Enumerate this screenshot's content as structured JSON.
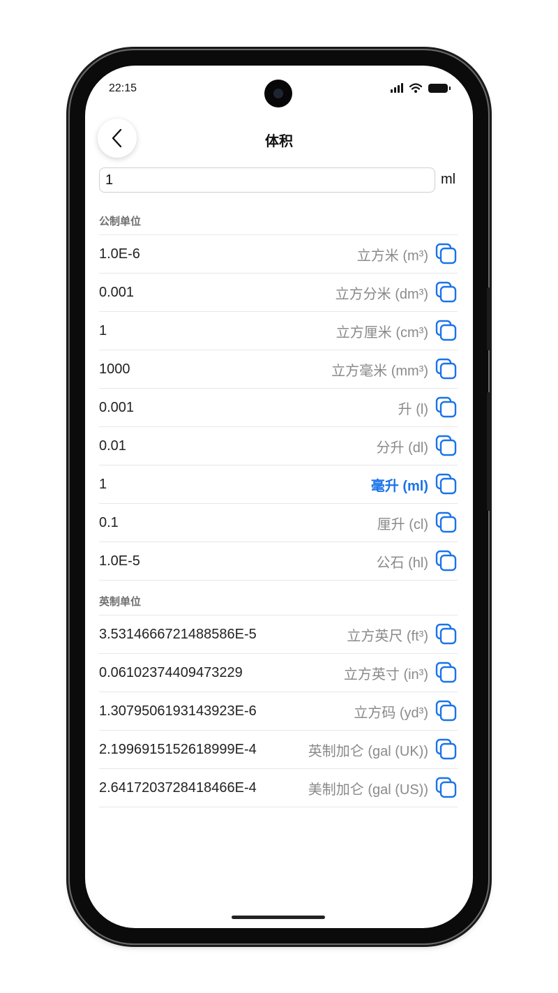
{
  "status": {
    "time": "22:15"
  },
  "header": {
    "title": "体积"
  },
  "input": {
    "value": "1",
    "unit": "ml"
  },
  "metric": {
    "title": "公制单位",
    "rows": [
      {
        "value": "1.0E-6",
        "unit": "立方米 (m³)"
      },
      {
        "value": "0.001",
        "unit": "立方分米 (dm³)"
      },
      {
        "value": "1",
        "unit": "立方厘米 (cm³)"
      },
      {
        "value": "1000",
        "unit": "立方毫米 (mm³)"
      },
      {
        "value": "0.001",
        "unit": "升 (l)"
      },
      {
        "value": "0.01",
        "unit": "分升 (dl)"
      },
      {
        "value": "1",
        "unit": "毫升 (ml)"
      },
      {
        "value": "0.1",
        "unit": "厘升 (cl)"
      },
      {
        "value": "1.0E-5",
        "unit": "公石 (hl)"
      }
    ]
  },
  "imperial": {
    "title": "英制单位",
    "rows": [
      {
        "value": "3.5314666721488586E-5",
        "unit": "立方英尺 (ft³)"
      },
      {
        "value": "0.06102374409473229",
        "unit": "立方英寸 (in³)"
      },
      {
        "value": "1.3079506193143923E-6",
        "unit": "立方码 (yd³)"
      },
      {
        "value": "2.1996915152618999E-4",
        "unit": "英制加仑 (gal (UK))"
      },
      {
        "value": "2.6417203728418466E-4",
        "unit": "美制加仑 (gal (US))"
      }
    ]
  },
  "colors": {
    "accent": "#1a73e8",
    "muted": "#8a8a8a"
  },
  "icons": {
    "back": "chevron-left-icon",
    "copy": "copy-icon"
  }
}
